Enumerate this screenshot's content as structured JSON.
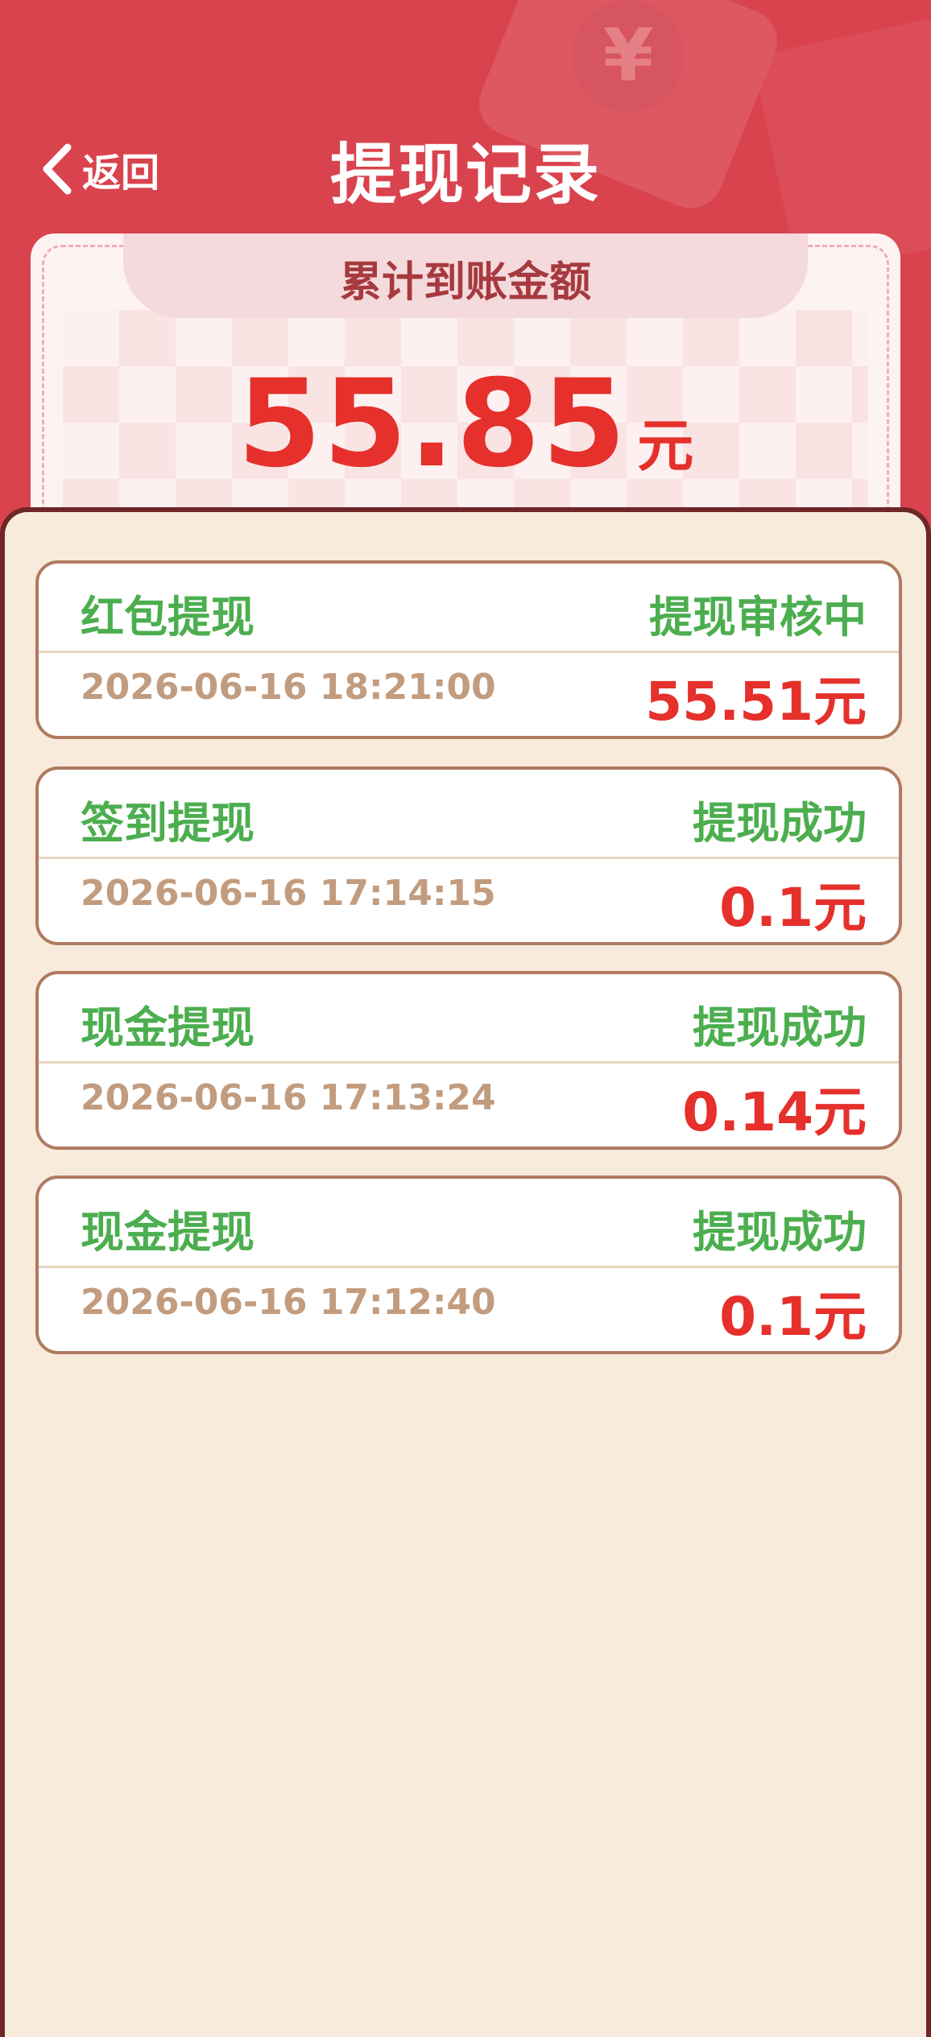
{
  "header": {
    "back_label": "返回",
    "title": "提现记录"
  },
  "summary": {
    "label": "累计到账金额",
    "amount": "55.85",
    "unit": "元"
  },
  "records": [
    {
      "type": "红包提现",
      "status": "提现审核中",
      "time": "2026-06-16 18:21:00",
      "amount": "55.51元"
    },
    {
      "type": "签到提现",
      "status": "提现成功",
      "time": "2026-06-16 17:14:15",
      "amount": "0.1元"
    },
    {
      "type": "现金提现",
      "status": "提现成功",
      "time": "2026-06-16 17:13:24",
      "amount": "0.14元"
    },
    {
      "type": "现金提现",
      "status": "提现成功",
      "time": "2026-06-16 17:12:40",
      "amount": "0.1元"
    }
  ],
  "colors": {
    "header_red": "#d9434d",
    "status_green": "#4cae4f",
    "amount_red": "#e5302b",
    "time_tan": "#c29c7f",
    "panel_bg": "#f8ebdc"
  }
}
